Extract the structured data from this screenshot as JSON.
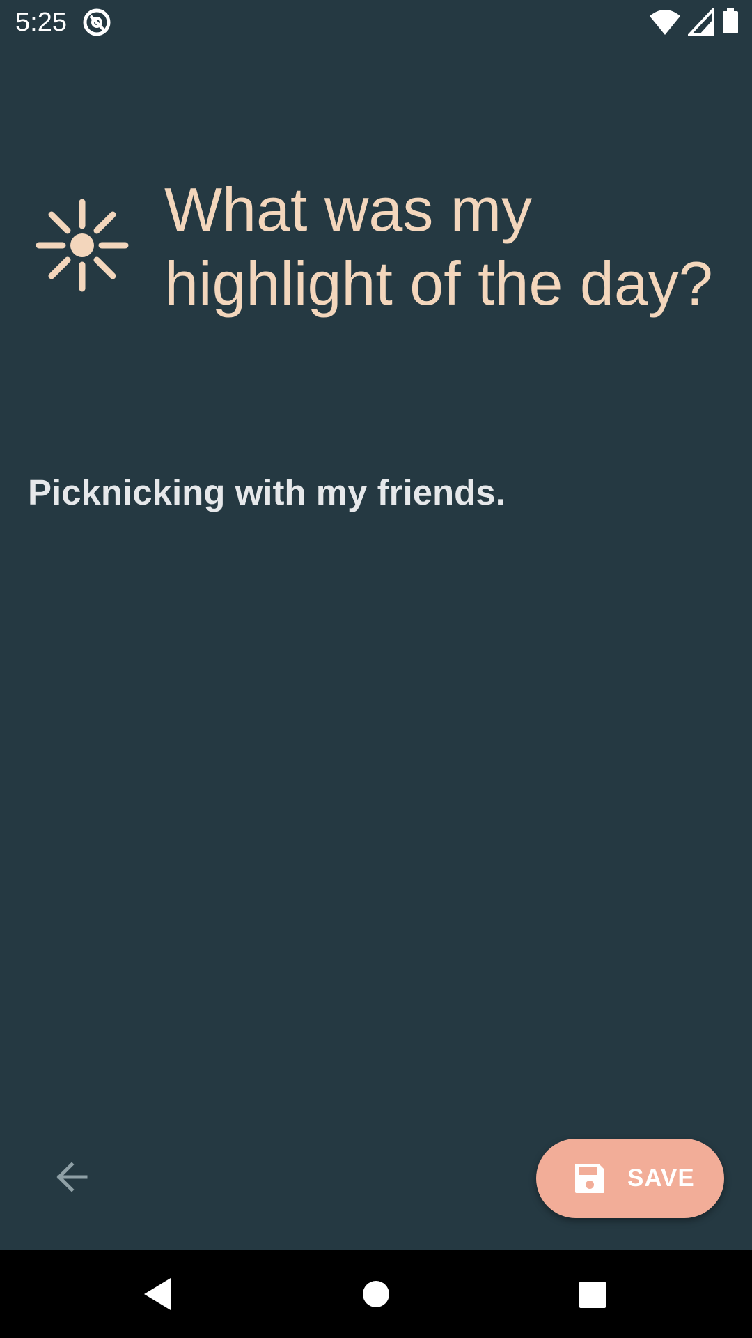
{
  "status_bar": {
    "time": "5:25",
    "app_icon": "at-sign-icon",
    "icons": [
      "wifi-icon",
      "cell-signal-icon",
      "battery-icon"
    ]
  },
  "prompt": {
    "icon": "sun-icon",
    "title": "What was my highlight of the day?"
  },
  "answer": {
    "text": "Picknicking with my friends."
  },
  "actions": {
    "back_icon": "arrow-left-icon",
    "save_icon": "floppy-disk-icon",
    "save_label": "SAVE"
  },
  "nav_bar": {
    "buttons": [
      "back-triangle-icon",
      "home-circle-icon",
      "recents-square-icon"
    ]
  },
  "colors": {
    "background": "#253942",
    "accent_text": "#f3d6bc",
    "save_button": "#f2ad98",
    "answer_text": "#e6e8ea",
    "nav_bar": "#000000"
  }
}
